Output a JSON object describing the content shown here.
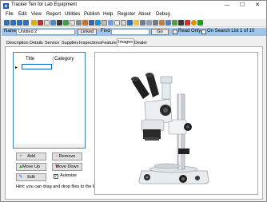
{
  "app": {
    "title": "Tracker Ten for Lab Equipment"
  },
  "window_controls": {
    "minimize": "—",
    "maximize": "☐",
    "close": "✕"
  },
  "menu": [
    "File",
    "Edit",
    "View",
    "Report",
    "Utilities",
    "Publish",
    "Help",
    "Register",
    "About",
    "Debug"
  ],
  "navbar": {
    "name_label": "Name",
    "name_value": "Untitled 2",
    "linked_label": "Linked",
    "find_label": "Find",
    "find_value": "",
    "go_label": "Go",
    "read_only_label": "Read Only",
    "on_search_list_label": "On Search List",
    "record_position": "1 of 10"
  },
  "tabs": [
    "Description",
    "Details",
    "Service",
    "Supplies",
    "Inspections",
    "Features",
    "Images",
    "Dealer"
  ],
  "active_tab": "Images",
  "image_list": {
    "columns": [
      "Title",
      "Category"
    ],
    "selected_marker": "▸"
  },
  "buttons": {
    "add": "Add",
    "remove": "Remove",
    "move_up": "Move Up",
    "move_down": "Move Down",
    "edit": "Edit",
    "autosize": "Autosize",
    "autosize_checked": true
  },
  "hint": "Hint: you can drag and drop files to the list.",
  "colors": {
    "navbar": "#9fc6e8",
    "accent": "#3c7fb1"
  }
}
